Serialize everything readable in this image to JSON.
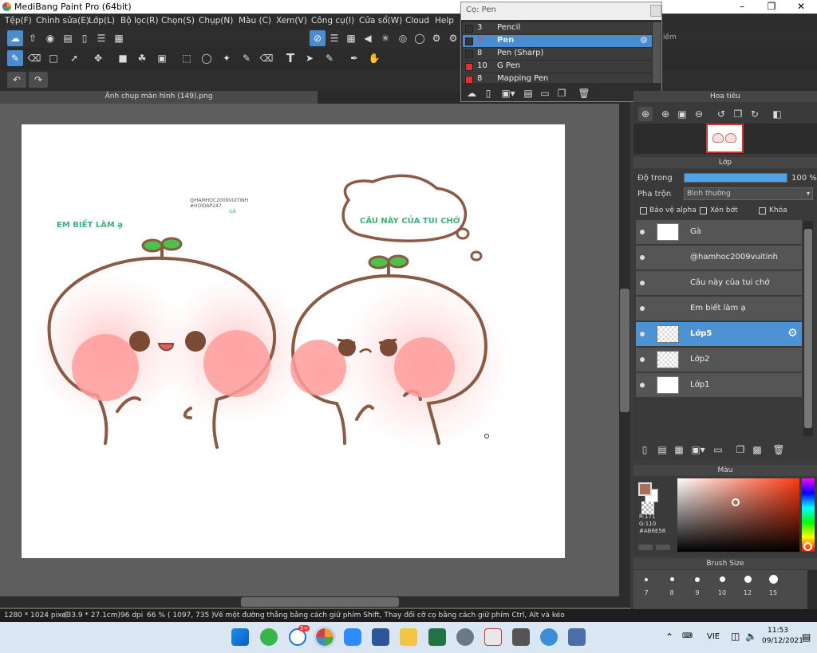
{
  "app": {
    "title": "MediBang Paint Pro (64bit)"
  },
  "menu": [
    "Tệp(F)",
    "Chỉnh sửa(E)",
    "Lớp(L)",
    "Bộ lọc(R)",
    "Chọn(S)",
    "Chụp(N)",
    "Màu (C)",
    "Xem(V)",
    "Công cụ(I)",
    "Cửa sổ(W)",
    "Cloud",
    "Help"
  ],
  "tab": {
    "label": "Ảnh chụp màn hình (149).png"
  },
  "brush_popup": {
    "title": "Cọ: Pen",
    "items": [
      {
        "num": "3",
        "name": "Pencil",
        "color": "#333333"
      },
      {
        "num": "7",
        "name": "Pen",
        "color": "#333333"
      },
      {
        "num": "8",
        "name": "Pen (Sharp)",
        "color": "#333333"
      },
      {
        "num": "10",
        "name": "G Pen",
        "color": "#e03030"
      },
      {
        "num": "8",
        "name": "Mapping Pen",
        "color": "#e03030"
      }
    ]
  },
  "partial_label": "iềm",
  "navigator": {
    "title": "Hoa tiêu"
  },
  "layers": {
    "title": "Lớp",
    "opacity_label": "Độ trong",
    "opacity_value": "100 %",
    "opacity": 1.0,
    "blend_label": "Pha trộn",
    "blend_value": "Bình thường",
    "protect_alpha": "Bảo vệ alpha",
    "clipping": "Xén bớt",
    "lock": "Khóa",
    "items": [
      "Gà",
      "@hamhoc2009vuitinh",
      "Câu này của tui chớ",
      "Em biết làm ạ",
      "Lớp5",
      "Lớp2",
      "Lớp1"
    ]
  },
  "color_panel": {
    "title": "Màu",
    "r": "R:171",
    "g": "G:110",
    "hex": "#AB6E58",
    "fg_color": "#AB6E58"
  },
  "brush_size": {
    "title": "Brush Size",
    "sizes": [
      "7",
      "8",
      "9",
      "10",
      "12",
      "15"
    ]
  },
  "canvas_text": {
    "em_biet": "EM BIẾT LÀM ạ",
    "handle": "@HAMHOC2009VUITINH",
    "hoidap": "#HOIDAP247",
    "ga": "GÀ",
    "bubble": "CÂU NÀY CỦA TUI CHỚ"
  },
  "status": {
    "size": "1280 * 1024 pixel",
    "cm": "(33.9 * 27.1cm)",
    "dpi": "96 dpi",
    "zoom": "66 %",
    "coords": "( 1097, 735 )",
    "hint": "Vẽ một đường thẳng bằng cách giữ phím Shift, Thay đổi cỡ cọ bằng cách giữ phím Ctrl, Alt và kéo"
  },
  "taskbar": {
    "lang": "VIE",
    "time": "11:53",
    "date": "09/12/2021",
    "badge": "5+"
  }
}
